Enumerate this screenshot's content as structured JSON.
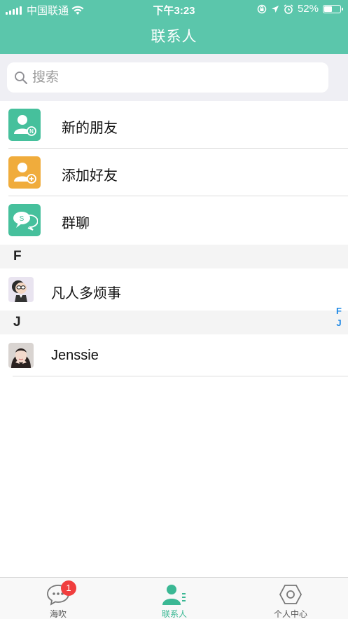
{
  "status_bar": {
    "carrier": "中国联通",
    "time": "下午3:23",
    "battery": "52%",
    "battery_level": 0.52
  },
  "header": {
    "title": "联系人"
  },
  "search": {
    "placeholder": "搜索"
  },
  "functions": [
    {
      "label": "新的朋友",
      "icon": "new-friend-icon",
      "color": "#46c09c"
    },
    {
      "label": "添加好友",
      "icon": "add-friend-icon",
      "color": "#f0ac3c"
    },
    {
      "label": "群聊",
      "icon": "group-chat-icon",
      "color": "#46c09c"
    }
  ],
  "sections": [
    {
      "letter": "F",
      "contacts": [
        {
          "name": "凡人多烦事"
        }
      ]
    },
    {
      "letter": "J",
      "contacts": [
        {
          "name": "Jenssie"
        }
      ]
    }
  ],
  "index_letters": [
    "F",
    "J"
  ],
  "tabs": [
    {
      "label": "海吹",
      "icon": "chat-bubble-icon",
      "badge": "1"
    },
    {
      "label": "联系人",
      "icon": "contacts-icon",
      "active": true
    },
    {
      "label": "个人中心",
      "icon": "hexagon-icon"
    }
  ],
  "colors": {
    "primary": "#5bc6ab",
    "accent_active": "#3bb894",
    "badge": "#f03e3e",
    "index_letters": "#1e88e5"
  }
}
